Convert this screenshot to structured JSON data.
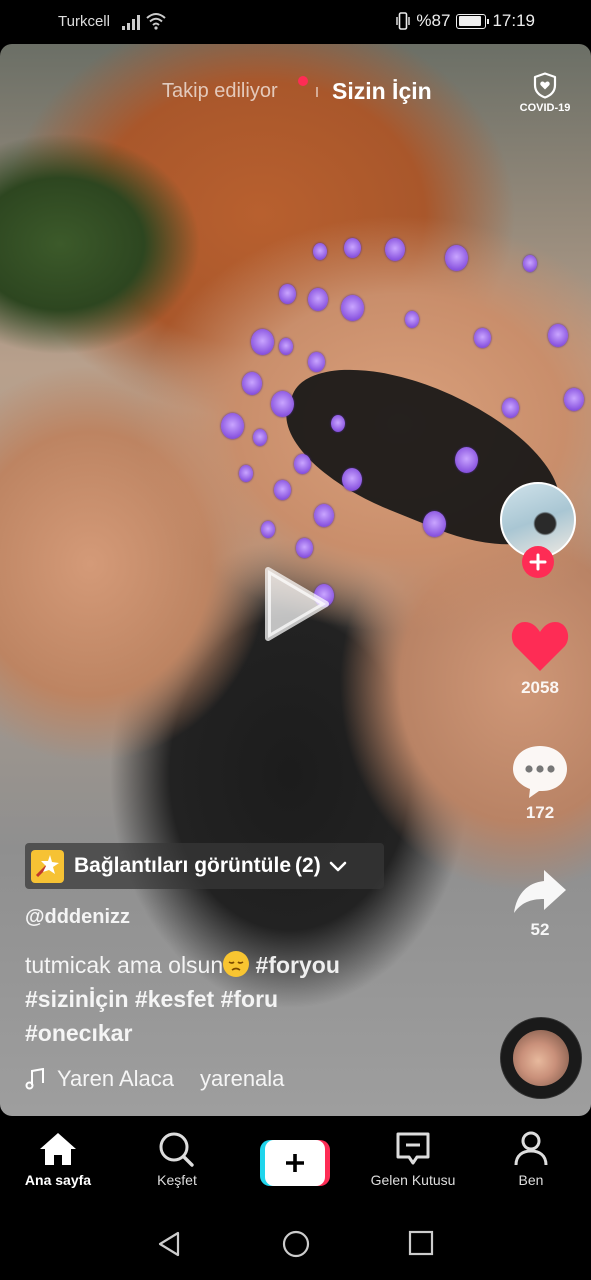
{
  "status_bar": {
    "carrier": "Turkcell",
    "battery_text": "%87",
    "battery_level": 0.87,
    "time": "17:19",
    "icons": [
      "signal-icon",
      "wifi-icon",
      "vibrate-icon",
      "battery-icon"
    ]
  },
  "top_nav": {
    "following_label": "Takip ediliyor",
    "foryou_label": "Sizin İçin",
    "covid_label": "COVID-19"
  },
  "rail": {
    "likes": "2058",
    "comments": "172",
    "shares": "52"
  },
  "links_chip": {
    "label": "Bağlantıları görüntüle",
    "count": "(2)"
  },
  "post": {
    "username": "@dddenizz",
    "caption_text": "tutmicak ama olsun",
    "hashtags_line1": "#foryou",
    "hashtags_line2": "#sizinİçin #kesfet #foru",
    "hashtags_line3": "#onecıkar",
    "music_artist": "Yaren Alaca",
    "music_user": "yarenala"
  },
  "tabbar": {
    "home": "Ana sayfa",
    "discover": "Keşfet",
    "inbox": "Gelen Kutusu",
    "me": "Ben"
  },
  "colors": {
    "accent_red": "#fe2c55",
    "accent_cyan": "#20d5ec",
    "chip_yellow": "#f6c234"
  }
}
